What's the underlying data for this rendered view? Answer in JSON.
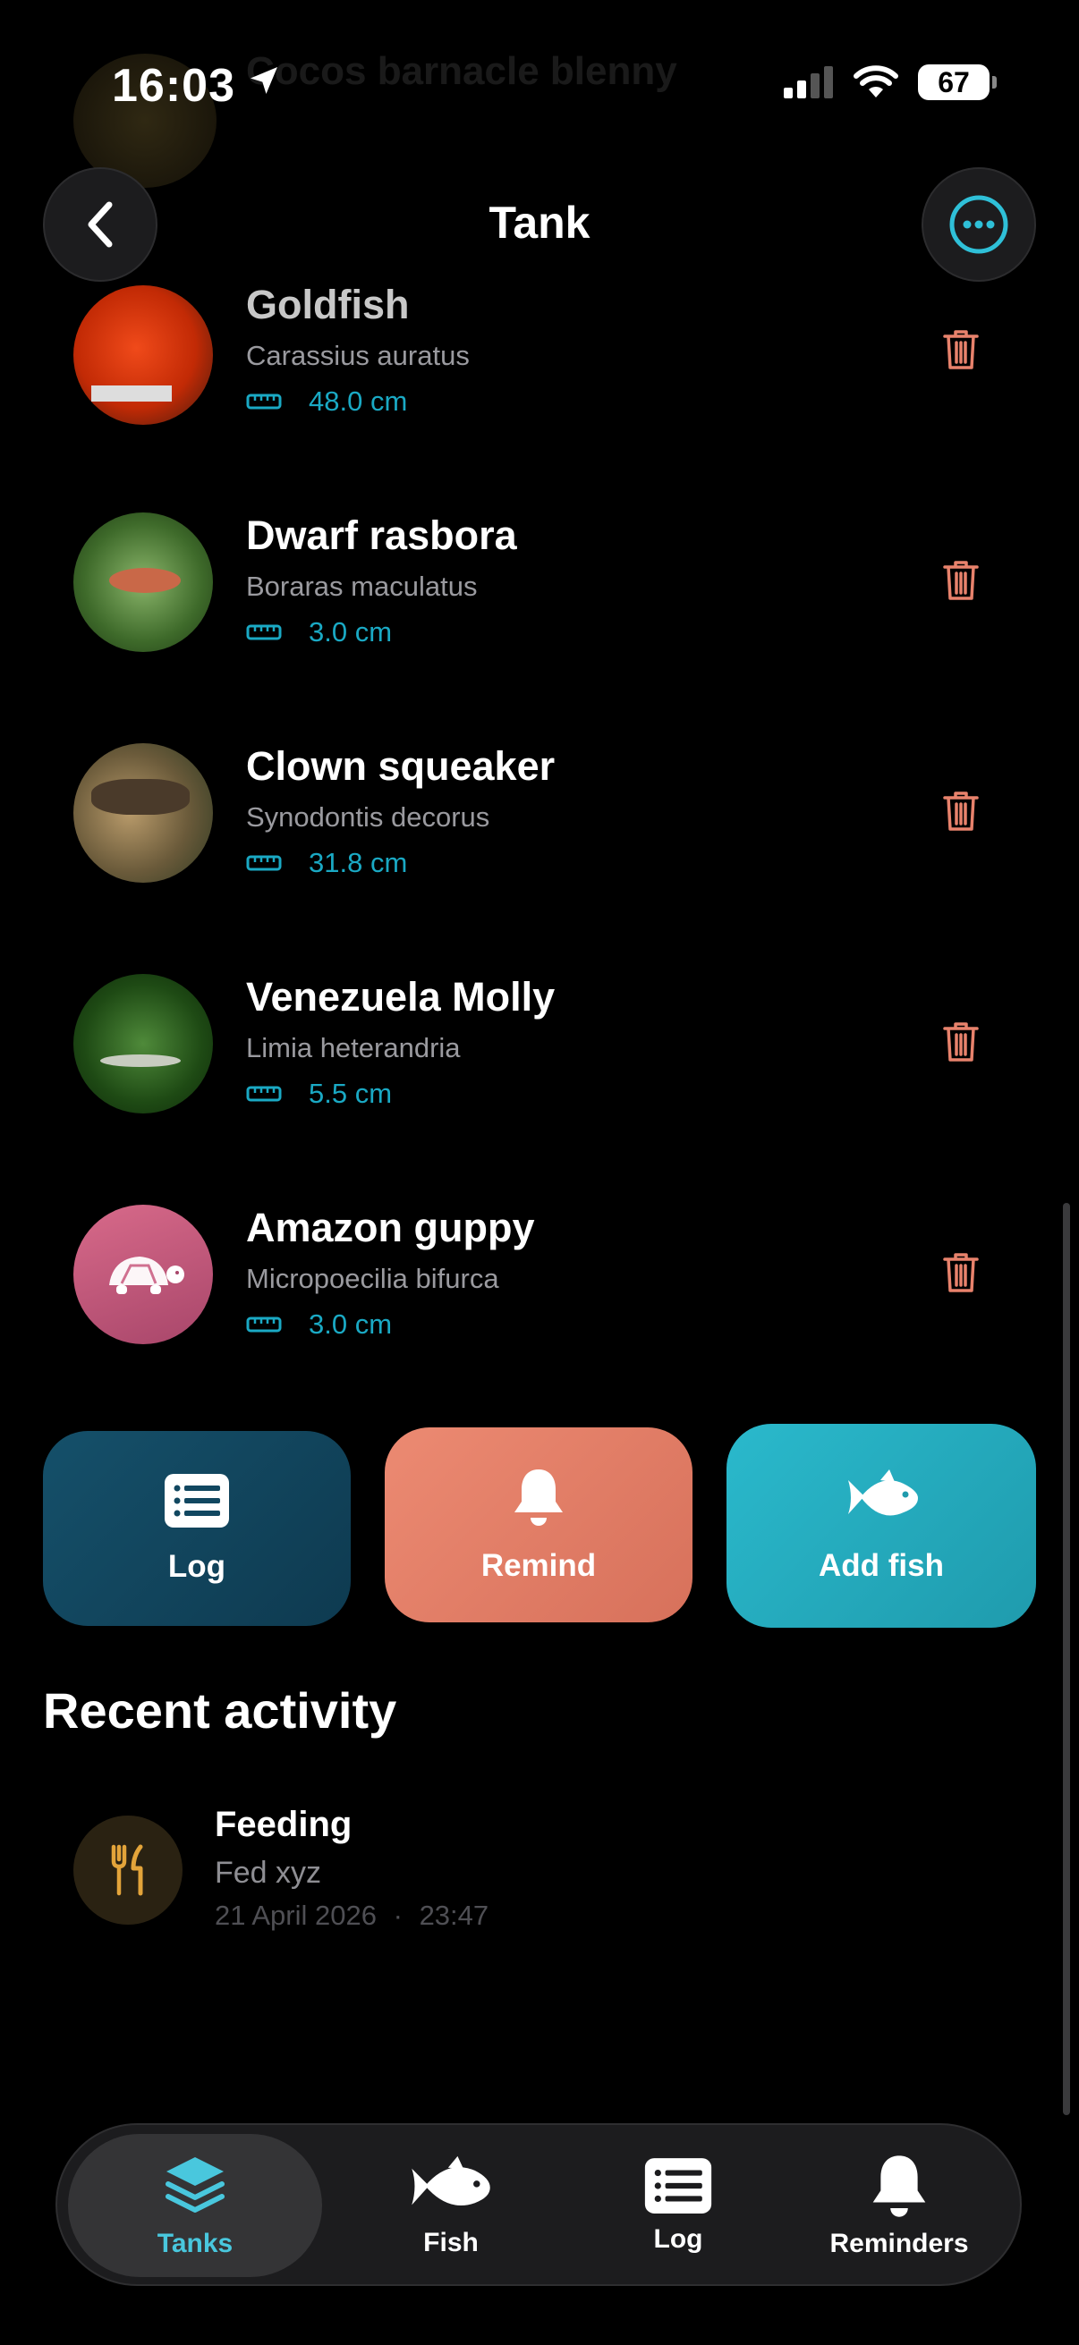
{
  "status": {
    "time": "16:03",
    "battery": "67"
  },
  "ghost_row": {
    "name": "Cocos barnacle blenny"
  },
  "header": {
    "title": "Tank"
  },
  "fish": [
    {
      "name": "Goldfish",
      "scientific": "Carassius auratus",
      "size": "48.0 cm"
    },
    {
      "name": "Dwarf rasbora",
      "scientific": "Boraras maculatus",
      "size": "3.0 cm"
    },
    {
      "name": "Clown squeaker",
      "scientific": "Synodontis decorus",
      "size": "31.8 cm"
    },
    {
      "name": "Venezuela Molly",
      "scientific": "Limia heterandria",
      "size": "5.5 cm"
    },
    {
      "name": "Amazon guppy",
      "scientific": "Micropoecilia bifurca",
      "size": "3.0 cm"
    }
  ],
  "actions": {
    "log": "Log",
    "remind": "Remind",
    "add_fish": "Add fish"
  },
  "recent": {
    "title": "Recent activity",
    "items": [
      {
        "title": "Feeding",
        "description": "Fed xyz",
        "date": "21 April 2026",
        "separator": "·",
        "time": "23:47"
      }
    ]
  },
  "tabs": [
    {
      "label": "Tanks",
      "active": true
    },
    {
      "label": "Fish",
      "active": false
    },
    {
      "label": "Log",
      "active": false
    },
    {
      "label": "Reminders",
      "active": false
    }
  ],
  "colors": {
    "accent": "#49c7dd",
    "size": "#1aa9c4",
    "trash": "#e8826c",
    "remind": "#ec8a72",
    "add": "#2ab9cc",
    "log": "#15506a"
  },
  "icons": {
    "back": "chevron-left-icon",
    "more": "ellipsis-icon",
    "ruler": "ruler-icon",
    "trash": "trash-icon",
    "feeding": "fork-knife-icon"
  }
}
